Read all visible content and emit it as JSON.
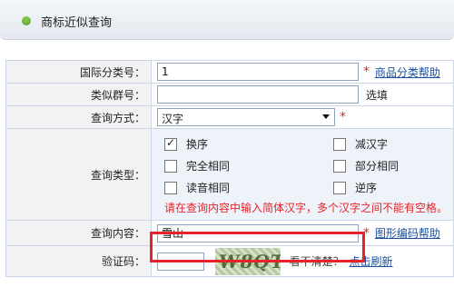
{
  "header": {
    "title": "商标近似查询"
  },
  "form": {
    "intl_class": {
      "label": "国际分类号：",
      "value": "1",
      "help_link": "商品分类帮助"
    },
    "group_no": {
      "label": "类似群号：",
      "value": "",
      "hint": "选填"
    },
    "query_method": {
      "label": "查询方式：",
      "selected": "汉字"
    },
    "query_type": {
      "label": "查询类型：",
      "options": [
        {
          "label": "换序",
          "checked": true
        },
        {
          "label": "减汉字",
          "checked": false
        },
        {
          "label": "完全相同",
          "checked": false
        },
        {
          "label": "部分相同",
          "checked": false
        },
        {
          "label": "读音相同",
          "checked": false
        },
        {
          "label": "逆序",
          "checked": false
        }
      ],
      "warning": "请在查询内容中输入简体汉字，多个汉字之间不能有空格。"
    },
    "query_content": {
      "label": "查询内容：",
      "value": "雪山",
      "help_link": "图形编码帮助"
    },
    "captcha": {
      "label": "验证码：",
      "value": "",
      "image_text": "W8QT",
      "unclear": "看不清楚？",
      "refresh_link": "点击刷新"
    }
  },
  "colors": {
    "required_star": "#e4262a",
    "highlight_box": "#e8222b",
    "link": "#1a4f9e"
  }
}
